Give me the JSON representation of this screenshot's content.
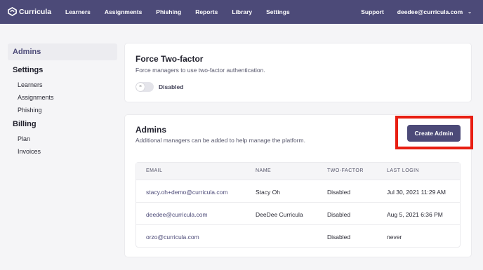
{
  "app": {
    "name": "Curricula"
  },
  "topnav": {
    "items": [
      "Learners",
      "Assignments",
      "Phishing",
      "Reports",
      "Library",
      "Settings"
    ],
    "support": "Support",
    "user_email": "deedee@curricula.com"
  },
  "sidebar": {
    "active": "Admins",
    "settings_heading": "Settings",
    "settings_items": [
      "Learners",
      "Assignments",
      "Phishing"
    ],
    "billing_heading": "Billing",
    "billing_items": [
      "Plan",
      "Invoices"
    ]
  },
  "two_factor": {
    "title": "Force Two-factor",
    "description": "Force managers to use two-factor authentication.",
    "toggle_state": "Disabled",
    "enabled": false
  },
  "admins": {
    "title": "Admins",
    "description": "Additional managers can be added to help manage the platform.",
    "create_button": "Create Admin",
    "highlight_color": "#e81e12",
    "columns": [
      "EMAIL",
      "NAME",
      "TWO-FACTOR",
      "LAST LOGIN"
    ],
    "rows": [
      {
        "email": "stacy.oh+demo@curricula.com",
        "name": "Stacy Oh",
        "two_factor": "Disabled",
        "last_login": "Jul 30, 2021 11:29 AM"
      },
      {
        "email": "deedee@curricula.com",
        "name": "DeeDee Curricula",
        "two_factor": "Disabled",
        "last_login": "Aug 5, 2021 6:36 PM"
      },
      {
        "email": "orzo@curricula.com",
        "name": "",
        "two_factor": "Disabled",
        "last_login": "never"
      }
    ]
  },
  "colors": {
    "brand": "#4c4a78",
    "background": "#f5f5f7"
  }
}
